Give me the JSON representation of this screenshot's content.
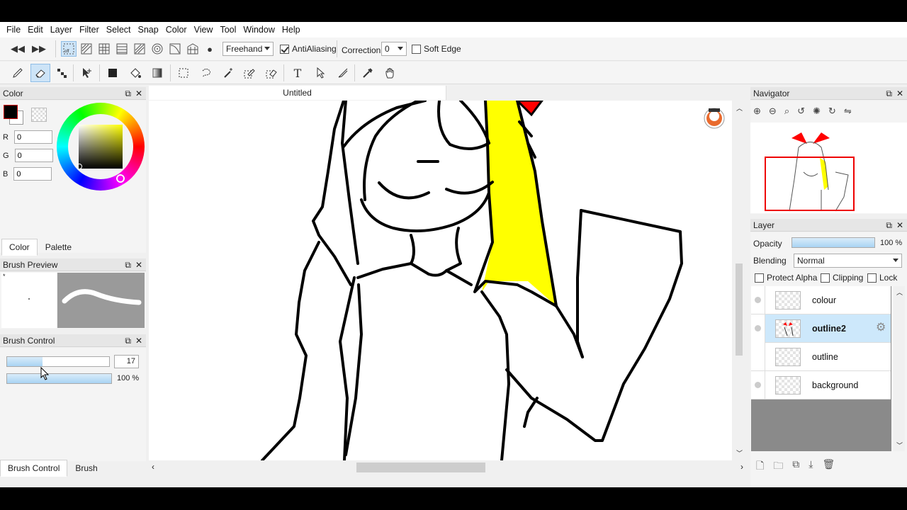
{
  "menu": [
    "File",
    "Edit",
    "Layer",
    "Filter",
    "Select",
    "Snap",
    "Color",
    "View",
    "Tool",
    "Window",
    "Help"
  ],
  "toolbar1": {
    "stroke_mode": "Freehand",
    "antialiasing_label": "AntiAliasing",
    "correction_label": "Correction",
    "correction_value": "0",
    "soft_edge_label": "Soft Edge"
  },
  "color_panel": {
    "title": "Color",
    "r_label": "R",
    "r_value": "0",
    "g_label": "G",
    "g_value": "0",
    "b_label": "B",
    "b_value": "0",
    "tab_color": "Color",
    "tab_palette": "Palette",
    "foreground_color": "#000000"
  },
  "brush_preview": {
    "title": "Brush Preview"
  },
  "brush_control": {
    "title": "Brush Control",
    "size_value": "17",
    "opacity_value": "100 %",
    "size_fraction": 0.35
  },
  "bottom_tabs": {
    "brush_control": "Brush Control",
    "brush": "Brush"
  },
  "document": {
    "tab_title": "Untitled"
  },
  "navigator": {
    "title": "Navigator"
  },
  "layer_panel": {
    "title": "Layer",
    "opacity_label": "Opacity",
    "opacity_value": "100 %",
    "blending_label": "Blending",
    "blending_value": "Normal",
    "protect_alpha": "Protect Alpha",
    "clipping": "Clipping",
    "lock": "Lock",
    "layers": [
      "colour",
      "outline2",
      "outline",
      "background"
    ]
  },
  "colors": {
    "accent_selected": "#cde8fb",
    "hair_yellow": "#ffff00",
    "bow_red": "#ff0000"
  }
}
